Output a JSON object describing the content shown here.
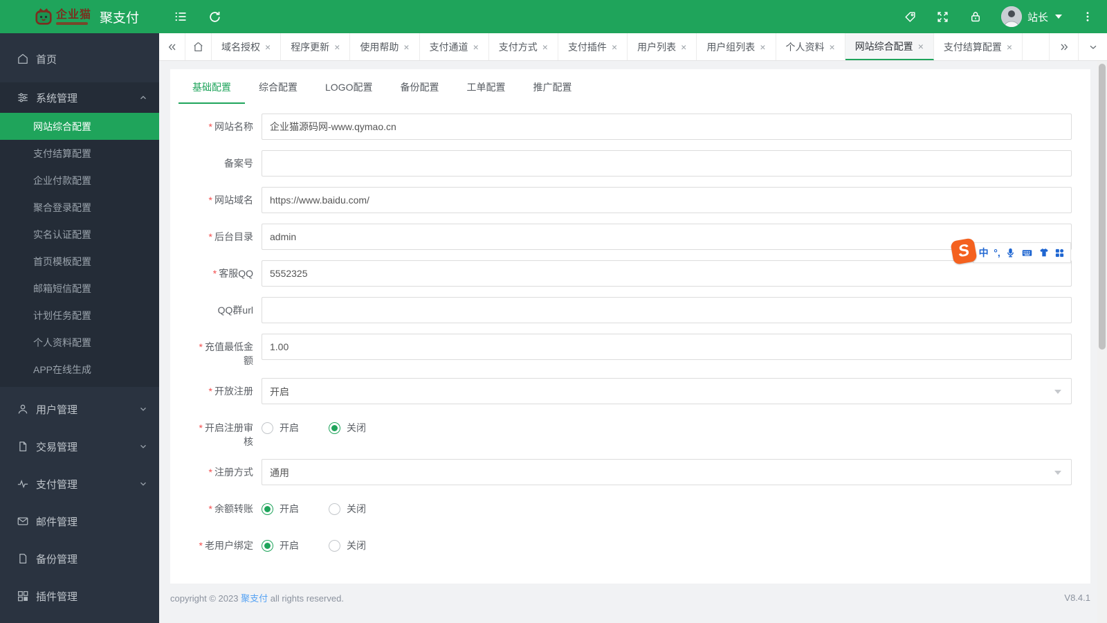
{
  "header": {
    "logo_text": "企业猫",
    "app_title": "聚支付",
    "user_name": "站长",
    "icons": [
      "menu-toggle",
      "refresh",
      "tag",
      "fullscreen",
      "lock",
      "more-vertical"
    ]
  },
  "tabbar": {
    "close_glyph": "×",
    "tabs": [
      {
        "label": "域名授权"
      },
      {
        "label": "程序更新"
      },
      {
        "label": "使用帮助"
      },
      {
        "label": "支付通道"
      },
      {
        "label": "支付方式"
      },
      {
        "label": "支付插件"
      },
      {
        "label": "用户列表"
      },
      {
        "label": "用户组列表"
      },
      {
        "label": "个人资料"
      },
      {
        "label": "网站综合配置",
        "active": true
      },
      {
        "label": "支付结算配置"
      }
    ]
  },
  "sidebar": {
    "home": "首页",
    "system_group": {
      "label": "系统管理",
      "children": [
        "网站综合配置",
        "支付结算配置",
        "企业付款配置",
        "聚合登录配置",
        "实名认证配置",
        "首页模板配置",
        "邮箱短信配置",
        "计划任务配置",
        "个人资料配置",
        "APP在线生成"
      ],
      "active_child": "网站综合配置"
    },
    "user_group": "用户管理",
    "trade_group": "交易管理",
    "pay_group": "支付管理",
    "mail_item": "邮件管理",
    "backup_item": "备份管理",
    "plugin_item": "插件管理"
  },
  "content": {
    "tabs": [
      {
        "label": "基础配置",
        "active": true
      },
      {
        "label": "综合配置"
      },
      {
        "label": "LOGO配置"
      },
      {
        "label": "备份配置"
      },
      {
        "label": "工单配置"
      },
      {
        "label": "推广配置"
      }
    ],
    "form": {
      "required_mark": "*",
      "rows": [
        {
          "label": "网站名称",
          "required": true,
          "type": "input",
          "value": "企业猫源码网-www.qymao.cn"
        },
        {
          "label": "备案号",
          "required": false,
          "type": "input",
          "value": ""
        },
        {
          "label": "网站域名",
          "required": true,
          "type": "input",
          "value": "https://www.baidu.com/"
        },
        {
          "label": "后台目录",
          "required": true,
          "type": "input",
          "value": "admin"
        },
        {
          "label": "客服QQ",
          "required": true,
          "type": "input",
          "value": "5552325"
        },
        {
          "label": "QQ群url",
          "required": false,
          "type": "input",
          "value": ""
        },
        {
          "label": "充值最低金额",
          "required": true,
          "type": "input",
          "value": "1.00"
        },
        {
          "label": "开放注册",
          "required": true,
          "type": "select",
          "value": "开启"
        },
        {
          "label": "开启注册审核",
          "required": true,
          "type": "radio",
          "option_on": "开启",
          "option_off": "关闭",
          "selected": "关闭"
        },
        {
          "label": "注册方式",
          "required": true,
          "type": "select",
          "value": "通用"
        },
        {
          "label": "余额转账",
          "required": true,
          "type": "radio",
          "option_on": "开启",
          "option_off": "关闭",
          "selected": "开启"
        },
        {
          "label": "老用户绑定",
          "required": true,
          "type": "radio",
          "option_on": "开启",
          "option_off": "关闭",
          "selected": "开启"
        }
      ]
    }
  },
  "ime": {
    "logo_letter": "S",
    "lang_label": "中",
    "punct_label": "°,",
    "icons": [
      "sogou-logo",
      "chinese-mode",
      "punctuation",
      "microphone",
      "keyboard",
      "skin",
      "toolbox"
    ]
  },
  "footer": {
    "copy_prefix": "copyright © 2023 ",
    "brand": "聚支付",
    "copy_suffix": " all rights reserved.",
    "version": "V8.4.1"
  },
  "colors": {
    "accent_green": "#1fa45b",
    "sidebar_bg": "#2a3340",
    "required_red": "#f34d4d",
    "ime_blue": "#1f66d1",
    "ime_orange": "#f4611f"
  }
}
